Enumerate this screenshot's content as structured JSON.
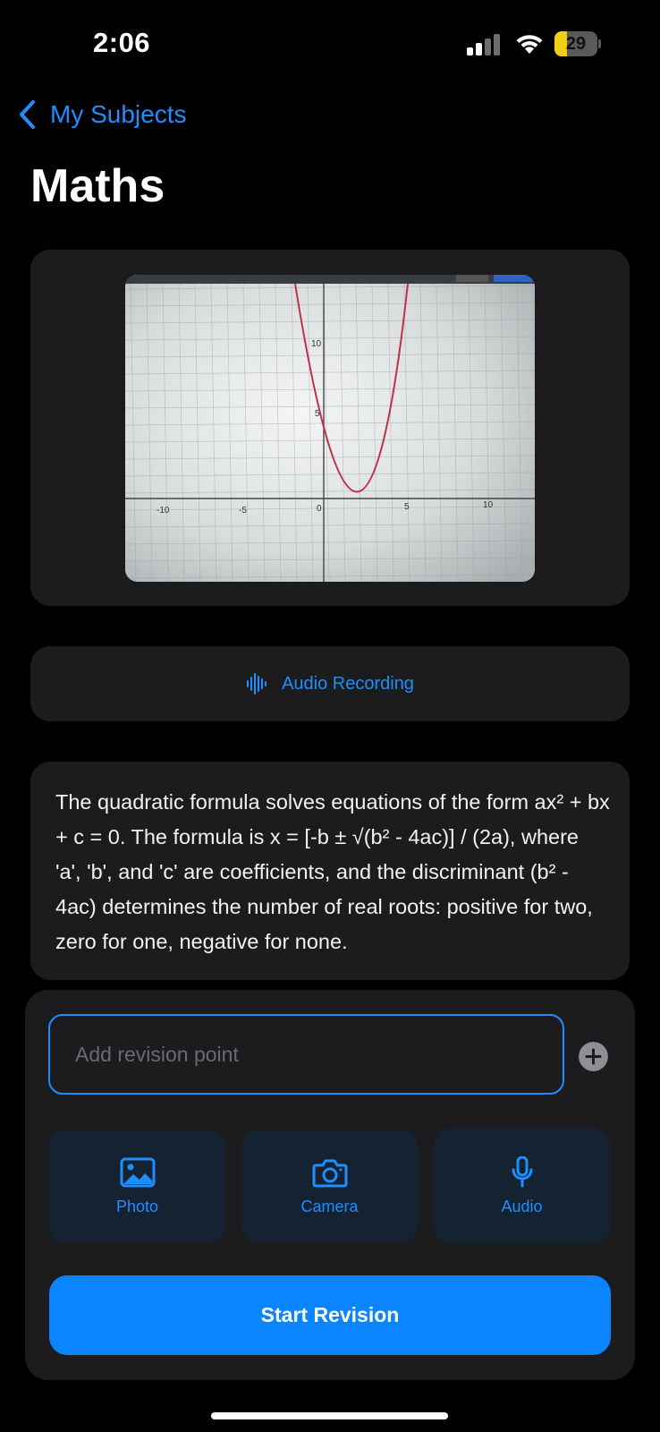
{
  "status_bar": {
    "time": "2:06",
    "battery_level": "29",
    "battery_fraction": 0.29
  },
  "nav": {
    "back_label": "My Subjects",
    "title": "Maths"
  },
  "media": {
    "graph": {
      "x_ticks": [
        "-10",
        "-5",
        "0",
        "5",
        "10"
      ],
      "y_ticks": [
        "10",
        "5"
      ],
      "curve_color": "#c0304a"
    }
  },
  "audio_recording": {
    "label": "Audio Recording"
  },
  "note": {
    "text": "The quadratic formula solves equations of the form ax² + bx + c = 0. The formula is x = [-b ± √(b² - 4ac)] / (2a), where 'a', 'b', and 'c' are coefficients, and the discriminant (b² - 4ac) determines the number of real roots: positive for two, zero for one, negative for none."
  },
  "composer": {
    "input": {
      "placeholder": "Add revision point",
      "value": ""
    },
    "tiles": [
      {
        "label": "Photo",
        "icon": "photo-icon"
      },
      {
        "label": "Camera",
        "icon": "camera-icon"
      },
      {
        "label": "Audio",
        "icon": "microphone-icon"
      }
    ],
    "start_button": "Start Revision"
  },
  "colors": {
    "accent": "#0a84ff",
    "card": "#1c1c1e",
    "background": "#000000",
    "battery": "#f3cf14"
  }
}
